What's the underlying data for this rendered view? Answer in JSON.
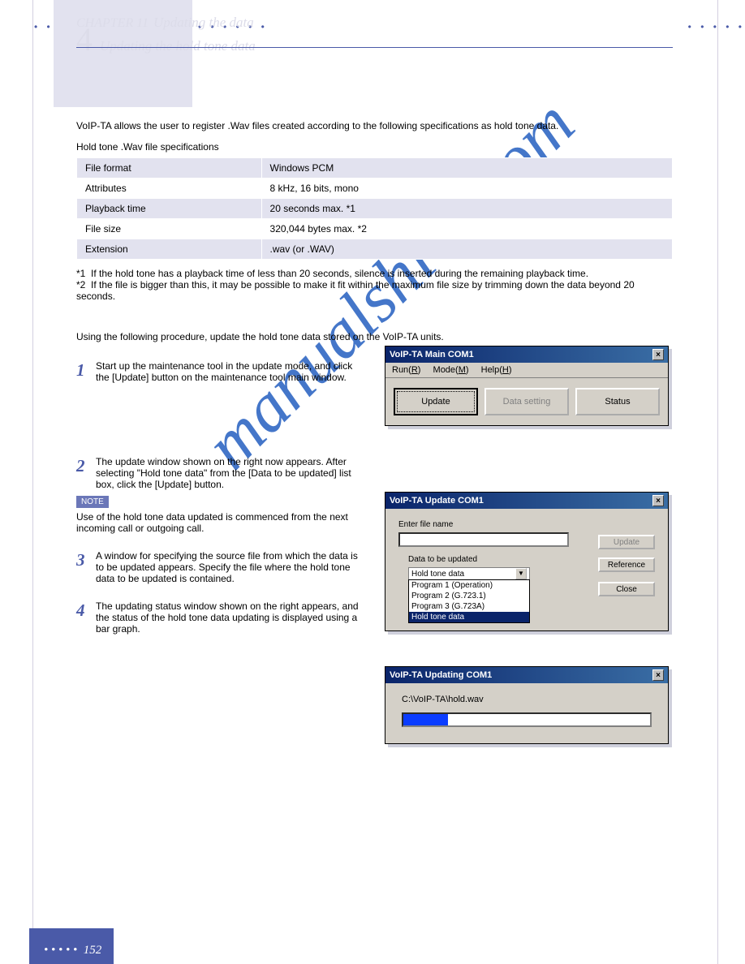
{
  "header": {
    "chapter_line": "CHAPTER 11",
    "chapter_title": "Updating the data",
    "section_num": "4",
    "section_title": "Updating the hold tone data"
  },
  "intro": "VoIP-TA allows the user to register .Wav files created according to the following specifications as hold tone data.",
  "table_intro": "Hold tone .Wav file specifications",
  "table": [
    [
      "File format",
      "Windows PCM"
    ],
    [
      "Attributes",
      "8 kHz, 16 bits, mono"
    ],
    [
      "Playback time",
      "20 seconds max.  *1"
    ],
    [
      "File size",
      "320,044 bytes max.   *2"
    ],
    [
      "Extension",
      ".wav (or .WAV)"
    ]
  ],
  "notes": {
    "n1": "If the hold tone has a playback time of less than 20 seconds, silence is inserted during the remaining playback time.",
    "n2": "If the file is bigger than this, it may be possible to make it fit within the maximum file size by trimming down the data beyond 20 seconds."
  },
  "procedure_lead": "Using the following procedure, update the hold tone data stored on the VoIP-TA units.",
  "steps": [
    {
      "n": "1",
      "body": "Start up the maintenance tool in the update mode, and click the [Update] button on the maintenance tool main window."
    },
    {
      "n": "2",
      "body": "The update window shown on the right now appears. After selecting \"Hold tone data\" from the [Data to be updated] list box, click the [Update] button."
    },
    {
      "n": "3",
      "body": "A window for specifying the source file from which the data is to be updated appears. Specify the file where the hold tone data to be updated is contained."
    },
    {
      "n": "4",
      "body": "The updating status window shown on the right appears, and the status of the hold tone data updating is displayed using a bar graph."
    }
  ],
  "note_tag": "NOTE",
  "note_text": "Use of the hold tone data updated is commenced from the next incoming call or outgoing call.",
  "windows": {
    "main": {
      "title": "VoIP-TA Main  COM1",
      "menu": {
        "run": "Run(R)",
        "mode": "Mode(M)",
        "help": "Help(H)"
      },
      "btn_update": "Update",
      "btn_data": "Data setting",
      "btn_status": "Status"
    },
    "update": {
      "title": "VoIP-TA Update  COM1",
      "enter": "Enter file name",
      "data_label": "Data to be updated",
      "selected": "Hold tone data",
      "options": [
        "Program 1 (Operation)",
        "Program 2 (G.723.1)",
        "Program 3 (G.723A)",
        "Hold tone data"
      ],
      "btn_update": "Update",
      "btn_ref": "Reference",
      "btn_close": "Close"
    },
    "updating": {
      "title": "VoIP-TA Updating  COM1",
      "path": "C:\\VoIP-TA\\hold.wav"
    }
  },
  "footer": {
    "page": "152"
  },
  "watermark": "manualshive.com"
}
